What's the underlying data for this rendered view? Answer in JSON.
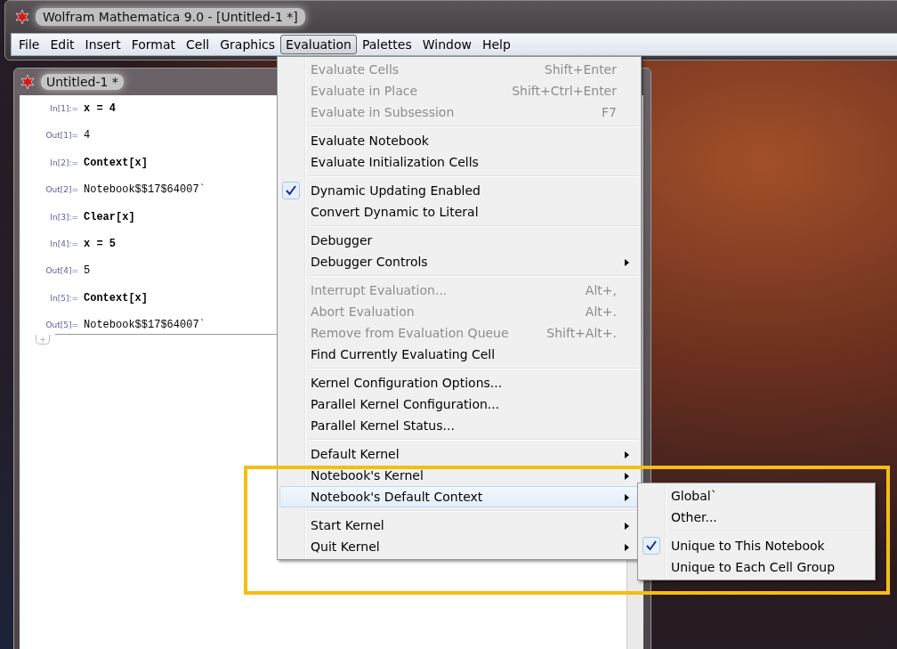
{
  "window": {
    "title": "Wolfram Mathematica 9.0 - [Untitled-1 *]"
  },
  "menubar": [
    {
      "label": "File",
      "selected": false
    },
    {
      "label": "Edit",
      "selected": false
    },
    {
      "label": "Insert",
      "selected": false
    },
    {
      "label": "Format",
      "selected": false
    },
    {
      "label": "Cell",
      "selected": false
    },
    {
      "label": "Graphics",
      "selected": false
    },
    {
      "label": "Evaluation",
      "selected": true
    },
    {
      "label": "Palettes",
      "selected": false
    },
    {
      "label": "Window",
      "selected": false
    },
    {
      "label": "Help",
      "selected": false
    }
  ],
  "notebook": {
    "title": "Untitled-1 *",
    "cells": [
      {
        "kind": "in",
        "label": "In[1]:=",
        "code": "x = 4"
      },
      {
        "kind": "out",
        "label": "Out[1]=",
        "code": "4"
      },
      {
        "kind": "in",
        "label": "In[2]:=",
        "code": "Context[x]"
      },
      {
        "kind": "out",
        "label": "Out[2]=",
        "code": "Notebook$$17$64007`"
      },
      {
        "kind": "in",
        "label": "In[3]:=",
        "code": "Clear[x]"
      },
      {
        "kind": "in",
        "label": "In[4]:=",
        "code": "x = 5"
      },
      {
        "kind": "out",
        "label": "Out[4]=",
        "code": "5"
      },
      {
        "kind": "in",
        "label": "In[5]:=",
        "code": "Context[x]"
      },
      {
        "kind": "out",
        "label": "Out[5]=",
        "code": "Notebook$$17$64007`"
      }
    ],
    "add_cell": "+"
  },
  "menu": {
    "groups": [
      [
        {
          "label": "Evaluate Cells",
          "shortcut": "Shift+Enter",
          "disabled": true,
          "checked": false,
          "submenu": false,
          "selected": false
        },
        {
          "label": "Evaluate in Place",
          "shortcut": "Shift+Ctrl+Enter",
          "disabled": true,
          "checked": false,
          "submenu": false,
          "selected": false
        },
        {
          "label": "Evaluate in Subsession",
          "shortcut": "F7",
          "disabled": true,
          "checked": false,
          "submenu": false,
          "selected": false
        }
      ],
      [
        {
          "label": "Evaluate Notebook",
          "disabled": false,
          "checked": false,
          "submenu": false,
          "selected": false
        },
        {
          "label": "Evaluate Initialization Cells",
          "disabled": false,
          "checked": false,
          "submenu": false,
          "selected": false
        }
      ],
      [
        {
          "label": "Dynamic Updating Enabled",
          "disabled": false,
          "checked": true,
          "submenu": false,
          "selected": false
        },
        {
          "label": "Convert Dynamic to Literal",
          "disabled": false,
          "checked": false,
          "submenu": false,
          "selected": false
        }
      ],
      [
        {
          "label": "Debugger",
          "disabled": false,
          "checked": false,
          "submenu": false,
          "selected": false
        },
        {
          "label": "Debugger Controls",
          "disabled": false,
          "checked": false,
          "submenu": true,
          "selected": false
        }
      ],
      [
        {
          "label": "Interrupt Evaluation...",
          "shortcut": "Alt+,",
          "disabled": true,
          "checked": false,
          "submenu": false,
          "selected": false
        },
        {
          "label": "Abort Evaluation",
          "shortcut": "Alt+.",
          "disabled": true,
          "checked": false,
          "submenu": false,
          "selected": false
        },
        {
          "label": "Remove from Evaluation Queue",
          "shortcut": "Shift+Alt+.",
          "disabled": true,
          "checked": false,
          "submenu": false,
          "selected": false
        },
        {
          "label": "Find Currently Evaluating Cell",
          "disabled": false,
          "checked": false,
          "submenu": false,
          "selected": false
        }
      ],
      [
        {
          "label": "Kernel Configuration Options...",
          "disabled": false,
          "checked": false,
          "submenu": false,
          "selected": false
        },
        {
          "label": "Parallel Kernel Configuration...",
          "disabled": false,
          "checked": false,
          "submenu": false,
          "selected": false
        },
        {
          "label": "Parallel Kernel Status...",
          "disabled": false,
          "checked": false,
          "submenu": false,
          "selected": false
        }
      ],
      [
        {
          "label": "Default Kernel",
          "disabled": false,
          "checked": false,
          "submenu": true,
          "selected": false
        },
        {
          "label": "Notebook's Kernel",
          "disabled": false,
          "checked": false,
          "submenu": true,
          "selected": false
        },
        {
          "label": "Notebook's Default Context",
          "disabled": false,
          "checked": false,
          "submenu": true,
          "selected": true
        }
      ],
      [
        {
          "label": "Start Kernel",
          "disabled": false,
          "checked": false,
          "submenu": true,
          "selected": false
        },
        {
          "label": "Quit Kernel",
          "disabled": false,
          "checked": false,
          "submenu": true,
          "selected": false
        }
      ]
    ]
  },
  "submenu": {
    "groups": [
      [
        {
          "label": "Global`",
          "checked": false
        },
        {
          "label": "Other...",
          "checked": false
        }
      ],
      [
        {
          "label": "Unique to This Notebook",
          "checked": true
        },
        {
          "label": "Unique to Each Cell Group",
          "checked": false
        }
      ]
    ]
  },
  "highlight_frame": {
    "shown": true
  }
}
